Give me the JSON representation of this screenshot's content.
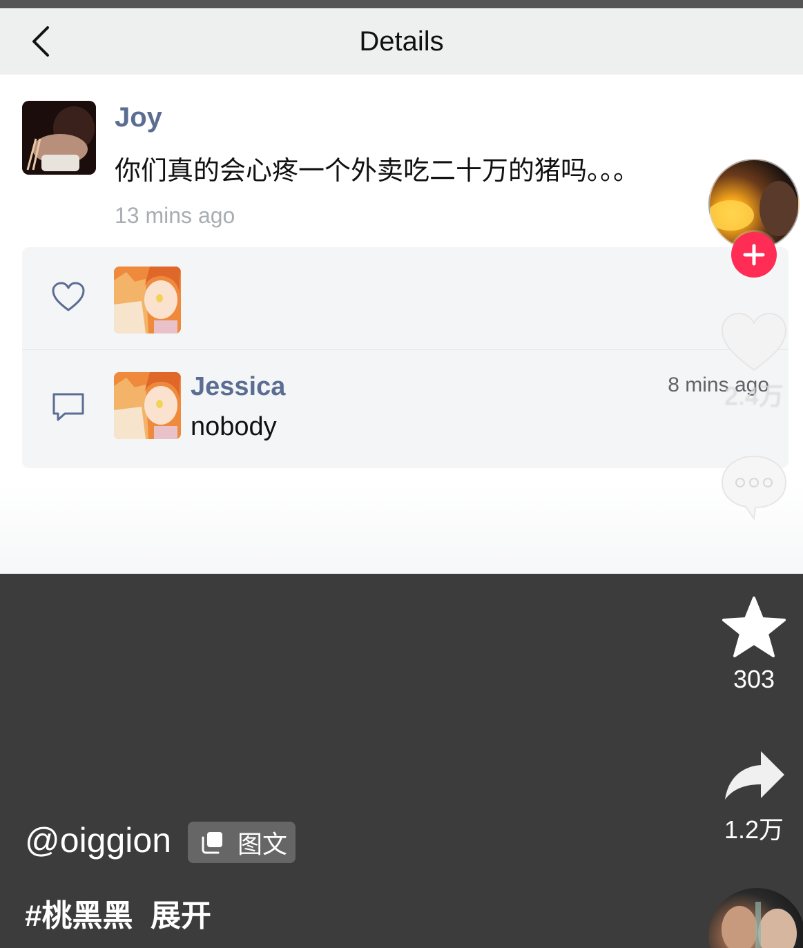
{
  "nav": {
    "title": "Details"
  },
  "post": {
    "author": "Joy",
    "text": "你们真的会心疼一个外卖吃二十万的猪吗。。。",
    "time": "13 mins ago"
  },
  "comment": {
    "author": "Jessica",
    "text": "nobody",
    "time": "8 mins ago"
  },
  "rail": {
    "like_count": "2.4万",
    "favorite_count": "303",
    "share_count": "1.2万"
  },
  "caption": {
    "handle": "@oiggion",
    "type_badge": "图文",
    "hashtag": "#桃黑黑",
    "expand": "展开"
  },
  "colors": {
    "link_blue": "#5b6d93",
    "follow_red": "#ff2c55",
    "dark_bg": "#3c3c3c"
  }
}
